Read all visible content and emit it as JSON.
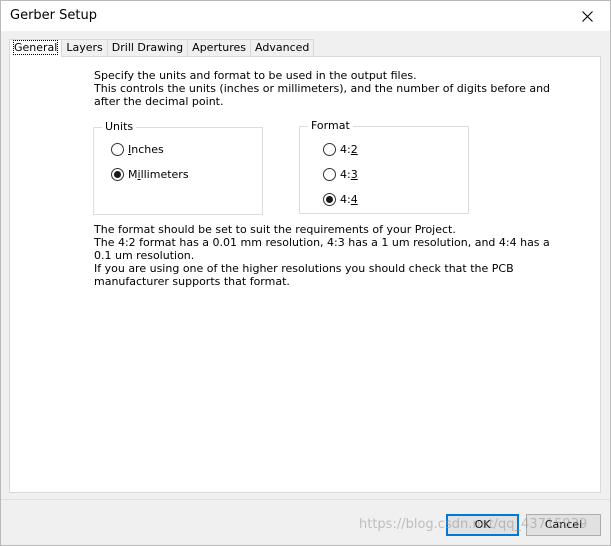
{
  "window": {
    "title": "Gerber Setup"
  },
  "tabs": [
    {
      "label": "General",
      "active": true
    },
    {
      "label": "Layers",
      "active": false
    },
    {
      "label": "Drill Drawing",
      "active": false
    },
    {
      "label": "Apertures",
      "active": false
    },
    {
      "label": "Advanced",
      "active": false
    }
  ],
  "intro": {
    "line1": "Specify the units and format to be used in the output files.",
    "line2": "This controls the units (inches or millimeters), and the number of digits before and",
    "line3": "after the decimal point."
  },
  "units_group": {
    "title": "Units",
    "options": [
      {
        "pre": "",
        "mnemonic": "I",
        "post": "nches",
        "selected": false
      },
      {
        "pre": "M",
        "mnemonic": "i",
        "post": "llimeters",
        "selected": true
      }
    ]
  },
  "format_group": {
    "title": "Format",
    "options": [
      {
        "pre": "4:",
        "mnemonic": "2",
        "post": "",
        "selected": false
      },
      {
        "pre": "4:",
        "mnemonic": "3",
        "post": "",
        "selected": false
      },
      {
        "pre": "4:",
        "mnemonic": "4",
        "post": "",
        "selected": true
      }
    ]
  },
  "notes": {
    "line1": "The format should be set to suit the requirements of your Project.",
    "line2": "The 4:2 format has a 0.01 mm resolution, 4:3 has a 1 um resolution, and 4:4 has a",
    "line3": "0.1 um resolution.",
    "line4": "If you are using one of the higher resolutions you should check that the PCB",
    "line5": "manufacturer supports that format."
  },
  "buttons": {
    "ok": "OK",
    "cancel": "Cancel"
  },
  "watermark": "https://blog.csdn.net/qq_43715939",
  "colors": {
    "accent": "#0078d7",
    "panel_bg": "#ffffff",
    "dialog_bg": "#f0f0f0"
  },
  "icons": {
    "close": "close-icon"
  }
}
